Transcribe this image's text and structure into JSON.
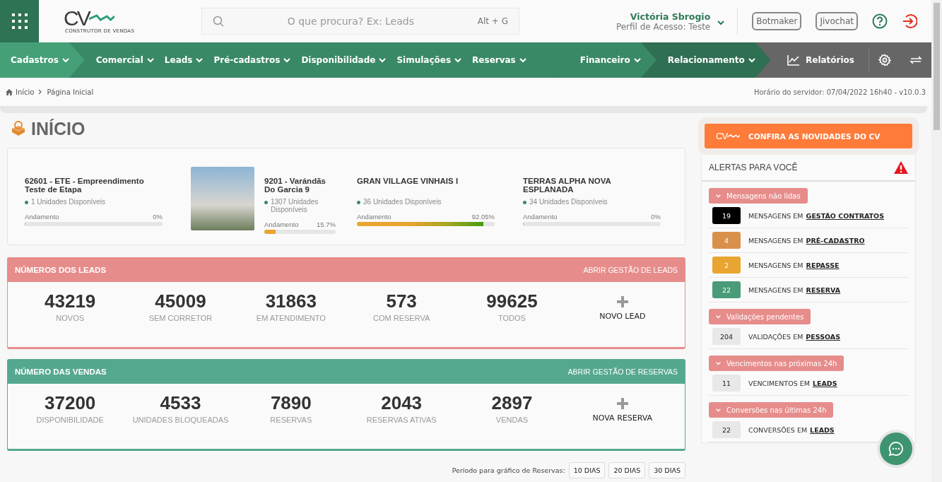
{
  "header": {
    "logo": {
      "mark": "CV",
      "tagline": "CONSTRUTOR DE VENDAS"
    },
    "search": {
      "placeholder": "O que procura? Ex: Leads",
      "shortcut": "Alt + G"
    },
    "user": {
      "name": "Victória Sbrogio",
      "profile": "Perfil de Acesso: Teste"
    },
    "buttons": [
      "Botmaker",
      "Jivochat"
    ]
  },
  "nav": [
    {
      "color": "#45a078",
      "items": [
        "Cadastros"
      ]
    },
    {
      "color": "#3a8966",
      "items": [
        "Comercial",
        "Leads",
        "Pré-cadastros",
        "Disponibilidade",
        "Simulações",
        "Reservas"
      ]
    },
    {
      "color": "#3a8966",
      "items": [
        "Financeiro"
      ]
    },
    {
      "color": "#2f6f53",
      "items": [
        "Relacionamento"
      ]
    }
  ],
  "reports": {
    "label": "Relatórios"
  },
  "breadcrumb": [
    "Início",
    "Página Inicial"
  ],
  "server_time": "Horário do servidor: 07/04/2022 16h40 - v10.0.3",
  "page_title": "INÍCIO",
  "projects": [
    {
      "name": "62601 - ETE - Empreendimento Teste de Etapa",
      "units": "1 Unidades Disponíveis",
      "progress_label": "Andamento",
      "reading": "0%",
      "level": 0,
      "photo": false
    },
    {
      "name": "9201 - Varándãs Do Garcia 9",
      "units": "1307 Unidades Disponíveis",
      "progress_label": "Andamento",
      "reading": "15.7%",
      "level": 0.157,
      "photo": true
    },
    {
      "name": "GRAN VILLAGE VINHAIS I",
      "units": "36 Unidades Disponíveis",
      "progress_label": "Andamento",
      "reading": "92.05%",
      "level": 0.9205,
      "photo": false
    },
    {
      "name": "TERRAS ALPHA NOVA ESPLANADA",
      "units": "34 Unidades Disponíveis",
      "progress_label": "Andamento",
      "reading": "0%",
      "level": 0,
      "photo": false
    }
  ],
  "panels": [
    {
      "title": "NÚMEROS DOS LEADS",
      "link": "ABRIR GESTÃO DE LEADS",
      "color": "#e68d8b",
      "stats": [
        {
          "value": "43219",
          "label": "NOVOS"
        },
        {
          "value": "45009",
          "label": "SEM CORRETOR"
        },
        {
          "value": "31863",
          "label": "EM ATENDIMENTO"
        },
        {
          "value": "573",
          "label": "COM RESERVA"
        },
        {
          "value": "99625",
          "label": "TODOS"
        }
      ],
      "action": "NOVO LEAD"
    },
    {
      "title": "NÚMERO DAS VENDAS",
      "link": "ABRIR GESTÃO DE RESERVAS",
      "color": "#55a890",
      "stats": [
        {
          "value": "37200",
          "label": "DISPONIBILIDADE"
        },
        {
          "value": "4533",
          "label": "UNIDADES BLOQUEADAS"
        },
        {
          "value": "7890",
          "label": "RESERVAS"
        },
        {
          "value": "2043",
          "label": "RESERVAS ATIVAS"
        },
        {
          "value": "2897",
          "label": "VENDAS"
        }
      ],
      "action": "NOVA RESERVA"
    }
  ],
  "period": {
    "label": "Período para gráfico de Reservas:",
    "options": [
      "10 DIAS",
      "20 DIAS",
      "30 DIAS"
    ]
  },
  "news_banner": {
    "mark": "CV",
    "label": "CONFIRA AS NOVIDADES DO CV"
  },
  "alerts": {
    "title": "ALERTAS PARA VOCÊ",
    "groups": [
      {
        "title": "Mensagens não lidas",
        "expanded": true,
        "items": [
          {
            "count": "19",
            "text": "MENSAGENS EM",
            "link": "GESTÃO CONTRATOS",
            "color": "#000000"
          },
          {
            "count": "4",
            "text": "MENSAGENS EM",
            "link": "PRÉ-CADASTRO",
            "color": "#d9904b"
          },
          {
            "count": "2",
            "text": "MENSAGENS EM",
            "link": "REPASSE",
            "color": "#e9a530"
          },
          {
            "count": "22",
            "text": "MENSAGENS EM",
            "link": "RESERVA",
            "color": "#4a9c78"
          }
        ]
      },
      {
        "title": "Validações pendentes",
        "expanded": true,
        "items": [
          {
            "count": "204",
            "text": "VALIDAÇÕES EM",
            "link": "PESSOAS",
            "color": "#e8e8e8"
          }
        ]
      },
      {
        "title": "Vencimentos nas próximas 24h",
        "expanded": true,
        "items": [
          {
            "count": "11",
            "text": "VENCIMENTOS EM",
            "link": "LEADS",
            "color": "#e8e8e8"
          }
        ]
      },
      {
        "title": "Conversões nas últimas 24h",
        "expanded": true,
        "items": [
          {
            "count": "22",
            "text": "CONVERSÕES EM",
            "link": "LEADS",
            "color": "#e8e8e8"
          }
        ]
      }
    ]
  }
}
